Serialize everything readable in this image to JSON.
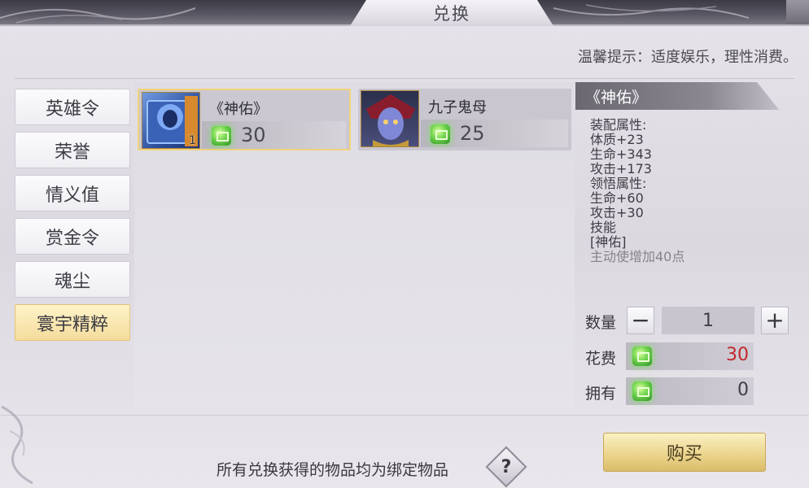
{
  "header": {
    "title": "兑换"
  },
  "tip": "温馨提示：适度娱乐，理性消费。",
  "tabs": [
    {
      "label": "英雄令",
      "active": false
    },
    {
      "label": "荣誉",
      "active": false
    },
    {
      "label": "情义值",
      "active": false
    },
    {
      "label": "赏金令",
      "active": false
    },
    {
      "label": "魂尘",
      "active": false
    },
    {
      "label": "寰宇精粹",
      "active": true
    }
  ],
  "items": [
    {
      "name": "《神佑》",
      "price": "30",
      "count": "1",
      "selected": true,
      "icon": "blue-book-icon"
    },
    {
      "name": "九子鬼母",
      "price": "25",
      "selected": false,
      "icon": "demon-mother-portrait"
    }
  ],
  "detail": {
    "title": "《神佑》",
    "desc_lines": [
      "装配属性:",
      "体质+23",
      "生命+343",
      "攻击+173",
      "",
      "领悟属性:",
      "生命+60",
      "攻击+30",
      "",
      "技能",
      "[神佑]",
      "主动使增加40点"
    ],
    "qty_label": "数量",
    "qty_value": "1",
    "cost_label": "花费",
    "cost_value": "30",
    "own_label": "拥有",
    "own_value": "0",
    "minus": "−",
    "plus": "+"
  },
  "footer": {
    "notice": "所有兑换获得的物品均为绑定物品",
    "help": "?",
    "buy": "购买"
  },
  "currency_icon": "green-gem-icon",
  "colors": {
    "accent_gold": "#f1d27a",
    "cost_red": "#c2282d"
  }
}
